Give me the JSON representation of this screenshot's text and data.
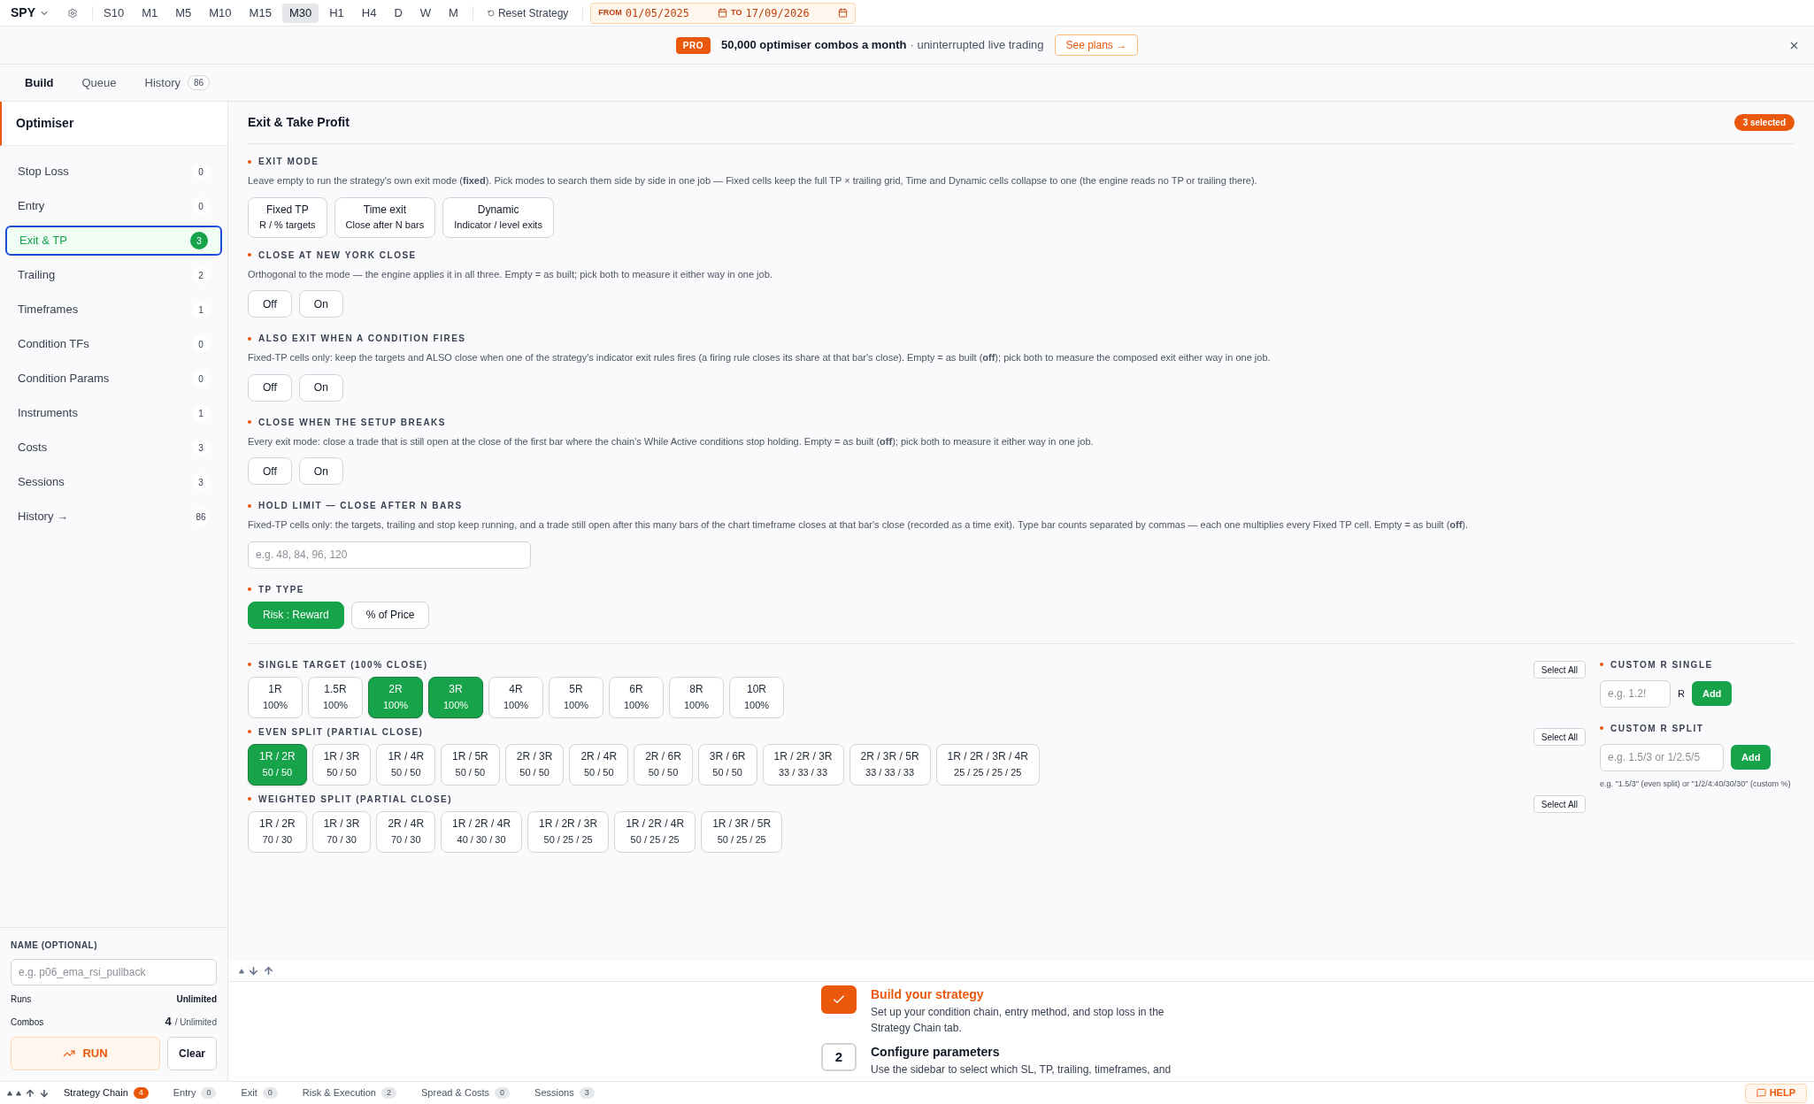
{
  "topbar": {
    "symbol": "SPY",
    "timeframes": [
      {
        "label": "S10",
        "selected": false
      },
      {
        "label": "M1",
        "selected": false
      },
      {
        "label": "M5",
        "selected": false
      },
      {
        "label": "M10",
        "selected": false
      },
      {
        "label": "M15",
        "selected": false
      },
      {
        "label": "M30",
        "selected": true
      },
      {
        "label": "H1",
        "selected": false
      },
      {
        "label": "H4",
        "selected": false
      },
      {
        "label": "D",
        "selected": false
      },
      {
        "label": "W",
        "selected": false
      },
      {
        "label": "M",
        "selected": false
      }
    ],
    "reset": "Reset Strategy",
    "from_label": "FROM",
    "from": "01/05/2025",
    "to_label": "TO",
    "to": "17/09/2026"
  },
  "banner": {
    "badge": "PRO",
    "headline": "50,000 optimiser combos a month",
    "rest": "· uninterrupted live trading",
    "cta": "See plans →"
  },
  "tabs": [
    {
      "label": "Build",
      "selected": true
    },
    {
      "label": "Queue",
      "selected": false
    },
    {
      "label": "History",
      "count": "86",
      "selected": false
    }
  ],
  "sidebar": {
    "title": "Optimiser",
    "items": [
      {
        "label": "Stop Loss",
        "count": "0",
        "selected": false
      },
      {
        "label": "Entry",
        "count": "0",
        "selected": false
      },
      {
        "label": "Exit & TP",
        "count": "3",
        "selected": true
      },
      {
        "label": "Trailing",
        "count": "2",
        "selected": false
      },
      {
        "label": "Timeframes",
        "count": "1",
        "selected": false
      },
      {
        "label": "Condition TFs",
        "count": "0",
        "selected": false
      },
      {
        "label": "Condition Params",
        "count": "0",
        "selected": false
      },
      {
        "label": "Instruments",
        "count": "1",
        "selected": false
      },
      {
        "label": "Costs",
        "count": "3",
        "selected": false
      },
      {
        "label": "Sessions",
        "count": "3",
        "selected": false
      },
      {
        "label": "History →",
        "count": "86",
        "selected": false
      }
    ],
    "name_label": "NAME (OPTIONAL)",
    "name_placeholder": "e.g. p06_ema_rsi_pullback",
    "runs_label": "Runs",
    "runs_value": "Unlimited",
    "combos_label": "Combos",
    "combos_value": "4",
    "combos_limit": "/ Unlimited",
    "run": "RUN",
    "clear": "Clear"
  },
  "panel": {
    "title": "Exit & Take Profit",
    "badge": "3 selected",
    "exit_mode": {
      "label": "EXIT MODE",
      "description": "Leave empty to run the strategy's own exit mode (**fixed**). Pick modes to search them side by side in one job — Fixed cells keep the full TP × trailing grid, Time and Dynamic cells collapse to one (the engine reads no TP or trailing there).",
      "options": [
        {
          "title": "Fixed TP",
          "subtitle": "R / % targets",
          "selected": false
        },
        {
          "title": "Time exit",
          "subtitle": "Close after N bars",
          "selected": false
        },
        {
          "title": "Dynamic",
          "subtitle": "Indicator / level exits",
          "selected": false
        }
      ]
    },
    "toggles": [
      {
        "label": "CLOSE AT NEW YORK CLOSE",
        "description": "Orthogonal to the mode — the engine applies it in all three. Empty = as built; pick both to measure it either way in one job.",
        "options": [
          {
            "label": "Off",
            "selected": false
          },
          {
            "label": "On",
            "selected": false
          }
        ]
      },
      {
        "label": "ALSO EXIT WHEN A CONDITION FIRES",
        "description": "Fixed-TP cells only: keep the targets and ALSO close when one of the strategy's indicator exit rules fires (a firing rule closes its share at that bar's close). Empty = as built (**off**); pick both to measure the composed exit either way in one job.",
        "options": [
          {
            "label": "Off",
            "selected": false
          },
          {
            "label": "On",
            "selected": false
          }
        ]
      },
      {
        "label": "CLOSE WHEN THE SETUP BREAKS",
        "description": "Every exit mode: close a trade that is still open at the close of the first bar where the chain's While Active conditions stop holding. Empty = as built (**off**); pick both to measure it either way in one job.",
        "options": [
          {
            "label": "Off",
            "selected": false
          },
          {
            "label": "On",
            "selected": false
          }
        ]
      }
    ],
    "hold_limit": {
      "label": "HOLD LIMIT — CLOSE AFTER N BARS",
      "description": "Fixed-TP cells only: the targets, trailing and stop keep running, and a trade still open after this many bars of the chart timeframe closes at that bar's close (recorded as a time exit). Type bar counts separated by commas — each one multiplies every Fixed TP cell. Empty = as built (**off**).",
      "placeholder": "e.g. 48, 84, 96, 120"
    },
    "tp_type": {
      "label": "TP TYPE",
      "options": [
        {
          "label": "Risk : Reward",
          "selected": true
        },
        {
          "label": "% of Price",
          "selected": false
        }
      ]
    },
    "groups": [
      {
        "label": "SINGLE TARGET (100% CLOSE)",
        "select_all": "Select All",
        "options": [
          {
            "r": "1R",
            "pct": "100%",
            "selected": false
          },
          {
            "r": "1.5R",
            "pct": "100%",
            "selected": false
          },
          {
            "r": "2R",
            "pct": "100%",
            "selected": true
          },
          {
            "r": "3R",
            "pct": "100%",
            "selected": true
          },
          {
            "r": "4R",
            "pct": "100%",
            "selected": false
          },
          {
            "r": "5R",
            "pct": "100%",
            "selected": false
          },
          {
            "r": "6R",
            "pct": "100%",
            "selected": false
          },
          {
            "r": "8R",
            "pct": "100%",
            "selected": false
          },
          {
            "r": "10R",
            "pct": "100%",
            "selected": false
          }
        ]
      },
      {
        "label": "EVEN SPLIT (PARTIAL CLOSE)",
        "select_all": "Select All",
        "options": [
          {
            "r": "1R / 2R",
            "pct": "50 / 50",
            "selected": true
          },
          {
            "r": "1R / 3R",
            "pct": "50 / 50",
            "selected": false
          },
          {
            "r": "1R / 4R",
            "pct": "50 / 50",
            "selected": false
          },
          {
            "r": "1R / 5R",
            "pct": "50 / 50",
            "selected": false
          },
          {
            "r": "2R / 3R",
            "pct": "50 / 50",
            "selected": false
          },
          {
            "r": "2R / 4R",
            "pct": "50 / 50",
            "selected": false
          },
          {
            "r": "2R / 6R",
            "pct": "50 / 50",
            "selected": false
          },
          {
            "r": "3R / 6R",
            "pct": "50 / 50",
            "selected": false
          },
          {
            "r": "1R / 2R / 3R",
            "pct": "33 / 33 / 33",
            "selected": false
          },
          {
            "r": "2R / 3R / 5R",
            "pct": "33 / 33 / 33",
            "selected": false
          },
          {
            "r": "1R / 2R / 3R / 4R",
            "pct": "25 / 25 / 25 / 25",
            "selected": false
          }
        ]
      },
      {
        "label": "WEIGHTED SPLIT (PARTIAL CLOSE)",
        "select_all": "Select All",
        "options": [
          {
            "r": "1R / 2R",
            "pct": "70 / 30",
            "selected": false
          },
          {
            "r": "1R / 3R",
            "pct": "70 / 30",
            "selected": false
          },
          {
            "r": "2R / 4R",
            "pct": "70 / 30",
            "selected": false
          },
          {
            "r": "1R / 2R / 4R",
            "pct": "40 / 30 / 30",
            "selected": false
          },
          {
            "r": "1R / 2R / 3R",
            "pct": "50 / 25 / 25",
            "selected": false
          },
          {
            "r": "1R / 2R / 4R",
            "pct": "50 / 25 / 25",
            "selected": false
          },
          {
            "r": "1R / 3R / 5R",
            "pct": "50 / 25 / 25",
            "selected": false
          }
        ]
      }
    ],
    "custom_single": {
      "label": "CUSTOM R SINGLE",
      "placeholder": "e.g. 1.2!",
      "unit": "R",
      "add": "Add"
    },
    "custom_split": {
      "label": "CUSTOM R SPLIT",
      "placeholder": "e.g. 1.5/3 or 1/2.5/5",
      "add": "Add",
      "hint": "e.g. \"1.5/3\" (even split) or \"1/2/4:40/30/30\" (custom %)"
    }
  },
  "guide": {
    "steps": [
      {
        "done": true,
        "title": "Build your strategy",
        "description": "Set up your condition chain, entry method, and stop loss in the Strategy Chain tab."
      },
      {
        "number": "2",
        "done": false,
        "title": "Configure parameters",
        "description": "Use the sidebar to select which SL, TP, trailing, timeframes, and"
      }
    ]
  },
  "bottom_tabs": [
    {
      "label": "Strategy Chain",
      "count": "4",
      "selected": true
    },
    {
      "label": "Entry",
      "count": "0",
      "selected": false
    },
    {
      "label": "Exit",
      "count": "0",
      "selected": false
    },
    {
      "label": "Risk & Execution",
      "count": "2",
      "selected": false
    },
    {
      "label": "Spread & Costs",
      "count": "0",
      "selected": false
    },
    {
      "label": "Sessions",
      "count": "3",
      "selected": false
    }
  ],
  "help": "HELP"
}
